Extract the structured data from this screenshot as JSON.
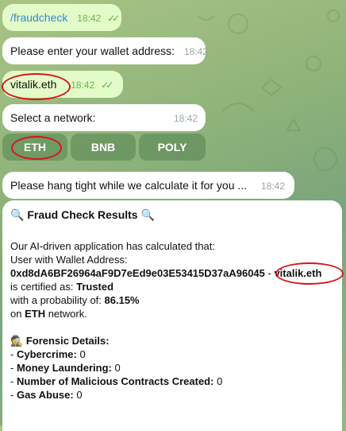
{
  "colors": {
    "outgoing_bubble": "#e3fbc8",
    "incoming_bubble": "#ffffff",
    "keyboard_button": "#5f8f5f",
    "highlight_ring": "#d8141c",
    "link": "#3a86c8"
  },
  "messages": [
    {
      "text": "/fraudcheck",
      "time": "18:42",
      "direction": "outgoing",
      "read_ticks": "✓✓"
    },
    {
      "text": "Please enter your wallet address:",
      "time": "18:42",
      "direction": "incoming"
    },
    {
      "text": "vitalik.eth",
      "time": "18:42",
      "direction": "outgoing",
      "read_ticks": "✓✓"
    },
    {
      "text": "Select a network:",
      "time": "18:42",
      "direction": "incoming"
    },
    {
      "text": "Please hang tight while we calculate it for you ...",
      "time": "18:42",
      "direction": "incoming"
    }
  ],
  "network_buttons": [
    "ETH",
    "BNB",
    "POLY"
  ],
  "results": {
    "title": "Fraud Check Results",
    "title_icon": "magnifier-icon",
    "line_calculated": "Our AI-driven application has calculated that:",
    "line_user": "User with Wallet Address:",
    "wallet_address": "0xd8dA6BF26964aF9D7eEd9e03E53415D37aA96045",
    "separator": " - ",
    "ens_name": "vitalik.eth",
    "certified_prefix": "is certified as: ",
    "certified_value": "Trusted",
    "probability_prefix": "with a probability of: ",
    "probability_value": "86.15%",
    "network_prefix": "on ",
    "network_value": "ETH",
    "network_suffix": " network.",
    "forensic_title": "Forensic Details:",
    "forensic_icon": "detective-icon",
    "forensic_items": [
      {
        "label": "Cybercrime:",
        "value": "0"
      },
      {
        "label": "Money Laundering:",
        "value": "0"
      },
      {
        "label": "Number of Malicious Contracts Created:",
        "value": "0"
      },
      {
        "label": "Gas Abuse:",
        "value": "0"
      }
    ]
  }
}
